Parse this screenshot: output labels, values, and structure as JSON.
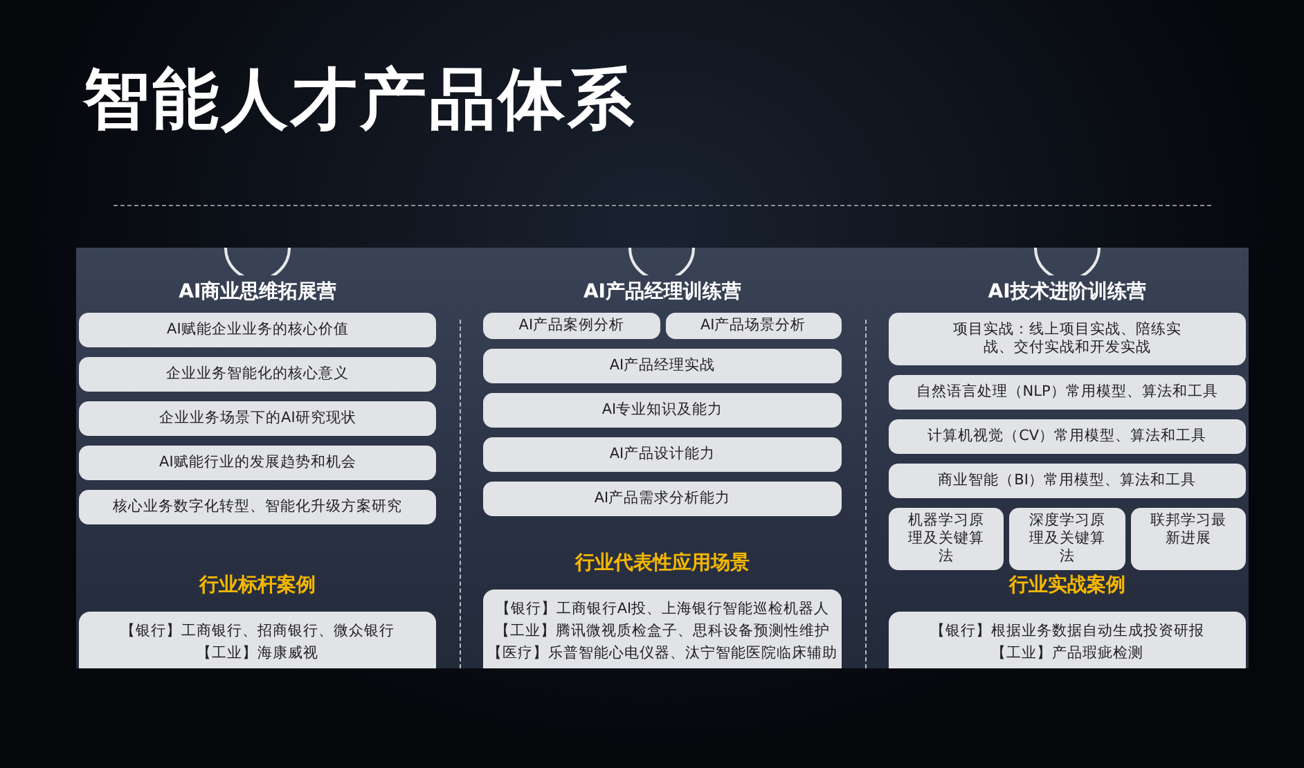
{
  "title": "智能人才产品体系",
  "columns": [
    {
      "title": "AI商业思维拓展营",
      "rows": [
        [
          "AI赋能企业业务的核心价值"
        ],
        [
          "企业业务智能化的核心意义"
        ],
        [
          "企业业务场景下的AI研究现状"
        ],
        [
          "AI赋能行业的发展趋势和机会"
        ],
        [
          "核心业务数字化转型、智能化升级方案研究"
        ]
      ],
      "case_heading": "行业标杆案例",
      "cases": [
        "【银行】工商银行、招商银行、微众银行",
        "【工业】海康威视"
      ]
    },
    {
      "title": "AI产品经理训练营",
      "rows": [
        [
          "AI产品案例分析",
          "AI产品场景分析"
        ],
        [
          "AI产品经理实战"
        ],
        [
          "AI专业知识及能力"
        ],
        [
          "AI产品设计能力"
        ],
        [
          "AI产品需求分析能力"
        ]
      ],
      "case_heading": "行业代表性应用场景",
      "cases": [
        "【银行】工商银行AI投、上海银行智能巡检机器人",
        "【工业】腾讯微视质检盒子、思科设备预测性维护",
        "【医疗】乐普智能心电仪器、汰宁智能医院临床辅助"
      ]
    },
    {
      "title": "AI技术进阶训练营",
      "rows": [
        [
          {
            "kind": "two-line",
            "text": "项目实战：线上项目实战、陪练实战、交付实战和开发实战"
          }
        ],
        [
          "自然语言处理（NLP）常用模型、算法和工具"
        ],
        [
          "计算机视觉（CV）常用模型、算法和工具"
        ],
        [
          "商业智能（BI）常用模型、算法和工具"
        ],
        [
          "机器学习原理及关键算法",
          "深度学习原理及关键算法",
          "联邦学习最新进展"
        ]
      ],
      "case_heading": "行业实战案例",
      "cases": [
        "【银行】根据业务数据自动生成投资研报",
        "【工业】产品瑕疵检测"
      ]
    }
  ]
}
